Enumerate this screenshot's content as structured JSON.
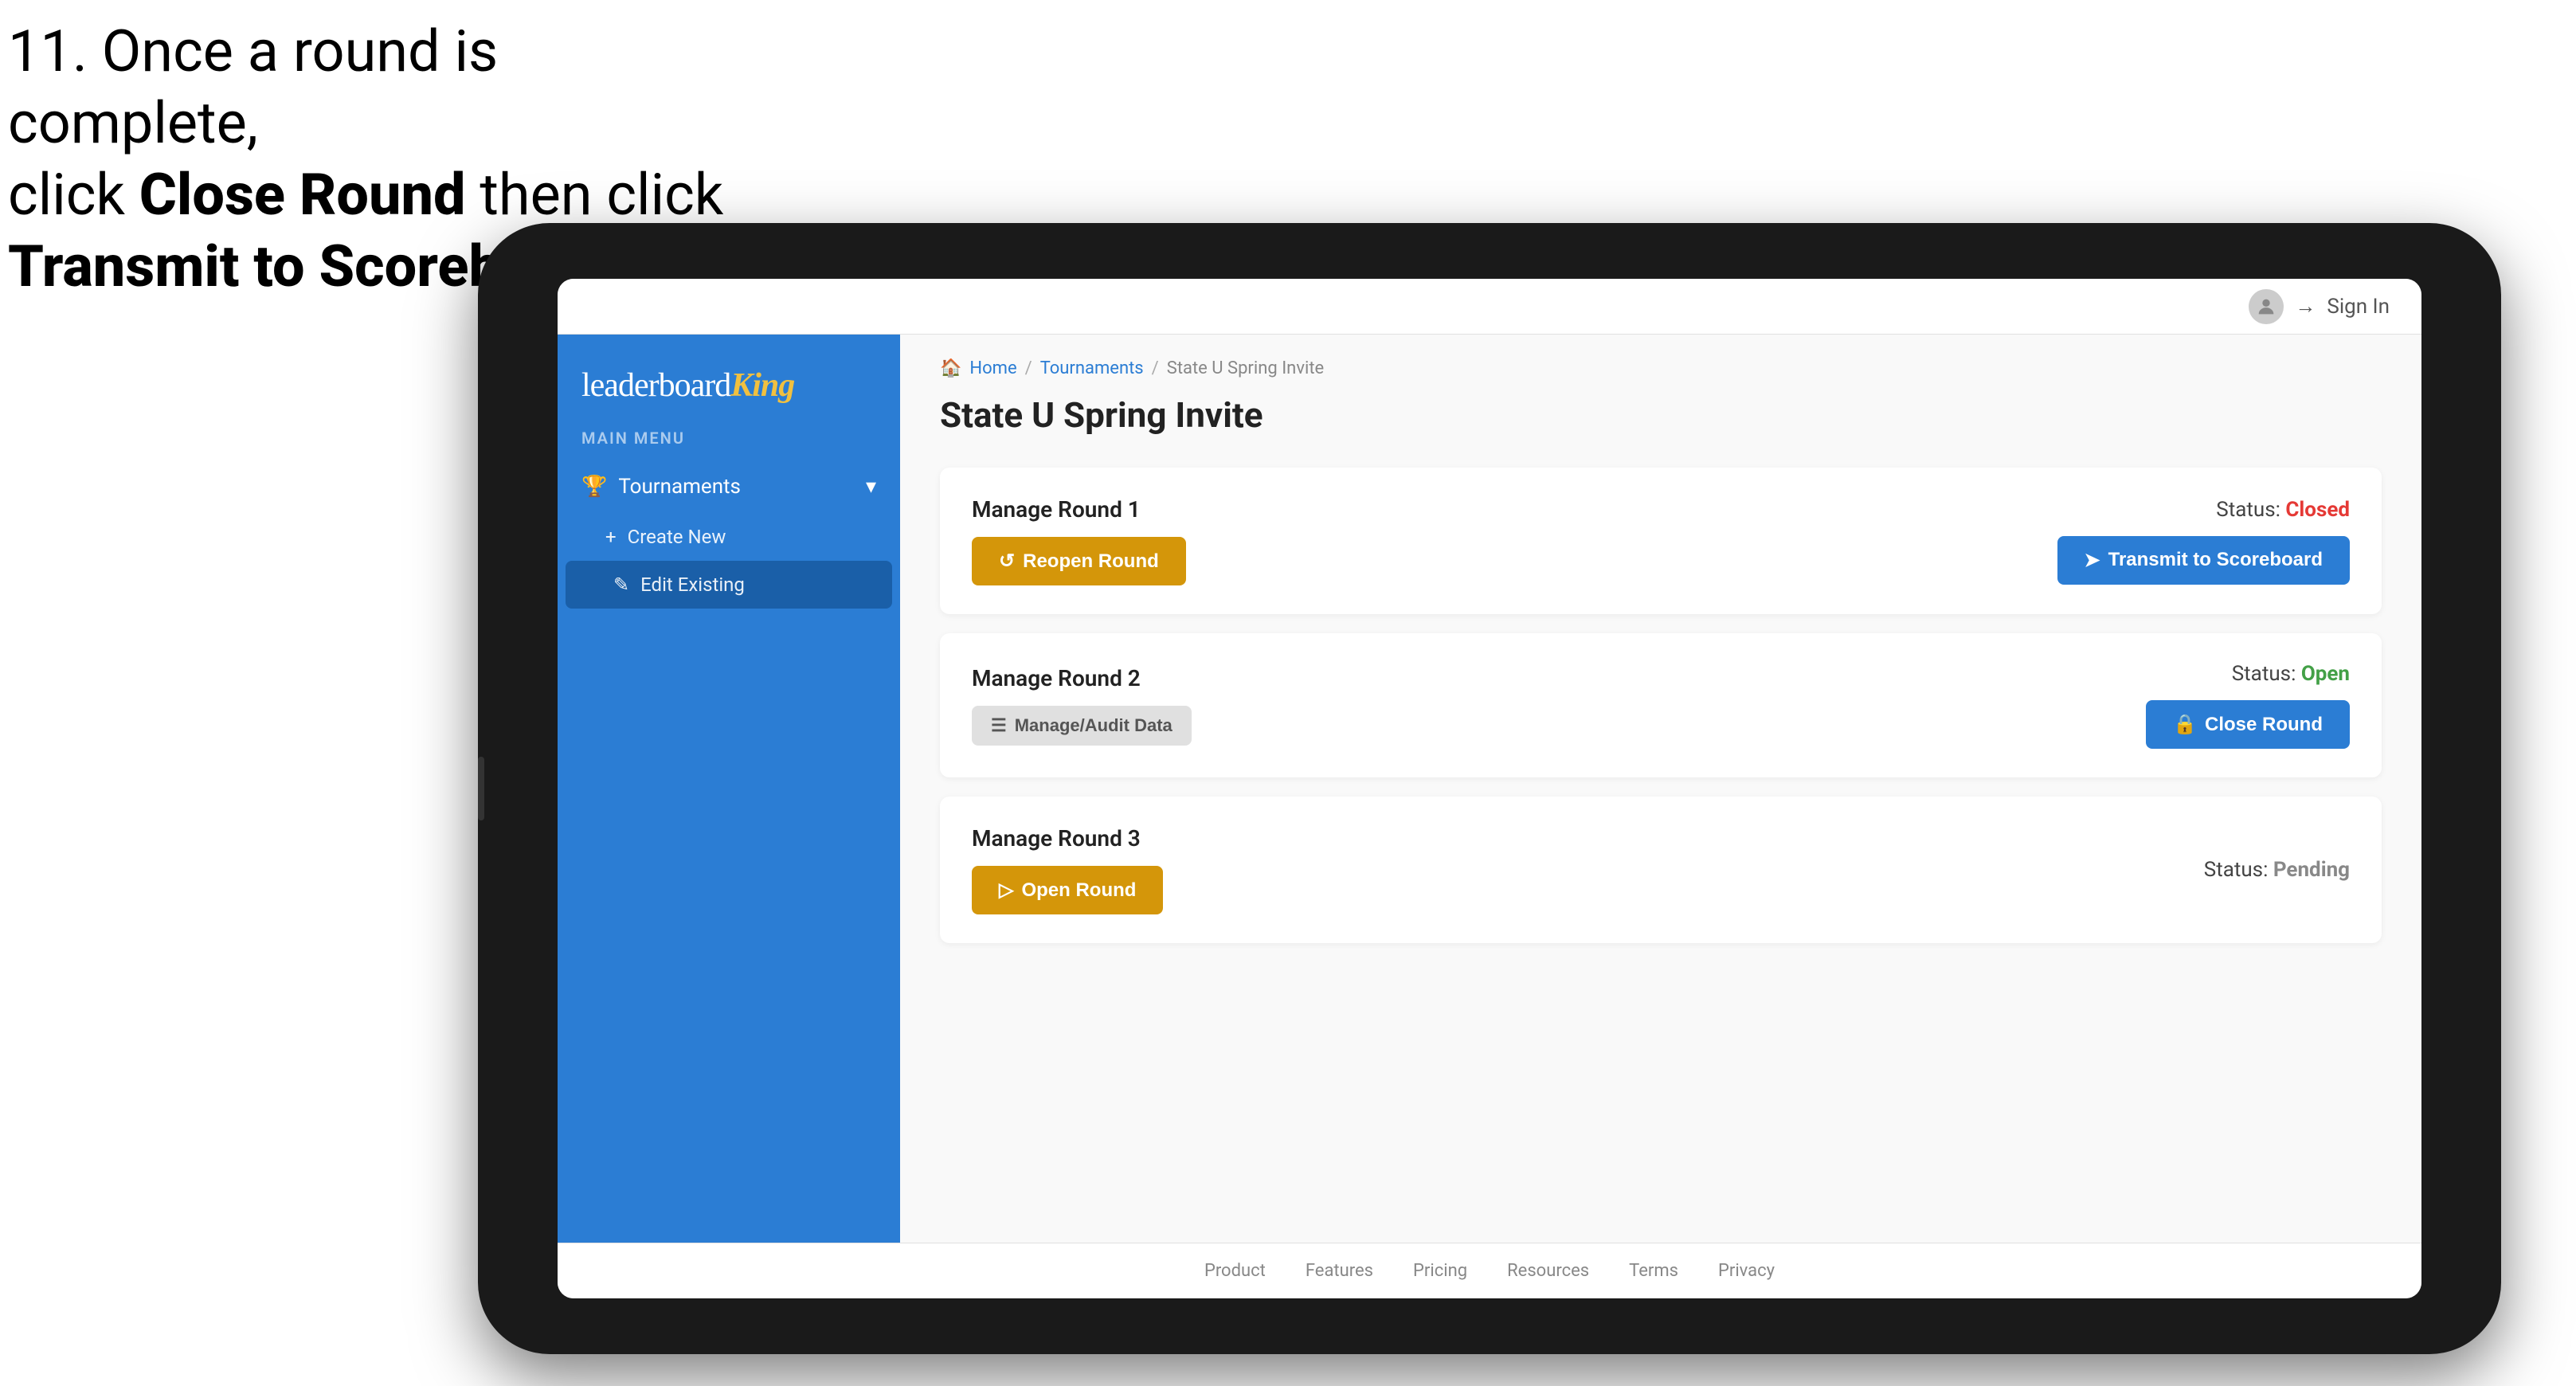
{
  "instruction": {
    "line1": "11. Once a round is complete,",
    "line2_prefix": "click ",
    "line2_bold": "Close Round",
    "line2_suffix": " then click",
    "line3_bold": "Transmit to Scoreboard."
  },
  "nav": {
    "sign_in": "Sign In"
  },
  "sidebar": {
    "logo_leaderboard": "leaderboard",
    "logo_king": "King",
    "main_menu_label": "MAIN MENU",
    "items": [
      {
        "label": "Tournaments",
        "icon": "trophy"
      }
    ],
    "sub_items": [
      {
        "label": "Create New",
        "icon": "plus"
      },
      {
        "label": "Edit Existing",
        "icon": "edit",
        "active": true
      }
    ]
  },
  "breadcrumb": {
    "home": "Home",
    "tournaments": "Tournaments",
    "current": "State U Spring Invite"
  },
  "page": {
    "title": "State U Spring Invite"
  },
  "rounds": [
    {
      "title": "Manage Round 1",
      "status_label": "Status:",
      "status_value": "Closed",
      "status_class": "status-closed",
      "buttons": [
        {
          "label": "Reopen Round",
          "type": "gold",
          "icon": "↺"
        },
        {
          "label": "Transmit to Scoreboard",
          "type": "blue",
          "icon": "➤"
        }
      ]
    },
    {
      "title": "Manage Round 2",
      "status_label": "Status:",
      "status_value": "Open",
      "status_class": "status-open",
      "buttons": [
        {
          "label": "Manage/Audit Data",
          "type": "gray",
          "icon": "☰"
        },
        {
          "label": "Close Round",
          "type": "blue",
          "icon": "🔒"
        }
      ]
    },
    {
      "title": "Manage Round 3",
      "status_label": "Status:",
      "status_value": "Pending",
      "status_class": "status-pending",
      "buttons": [
        {
          "label": "Open Round",
          "type": "gold",
          "icon": "⊳"
        }
      ]
    }
  ],
  "footer": {
    "links": [
      "Product",
      "Features",
      "Pricing",
      "Resources",
      "Terms",
      "Privacy"
    ]
  }
}
